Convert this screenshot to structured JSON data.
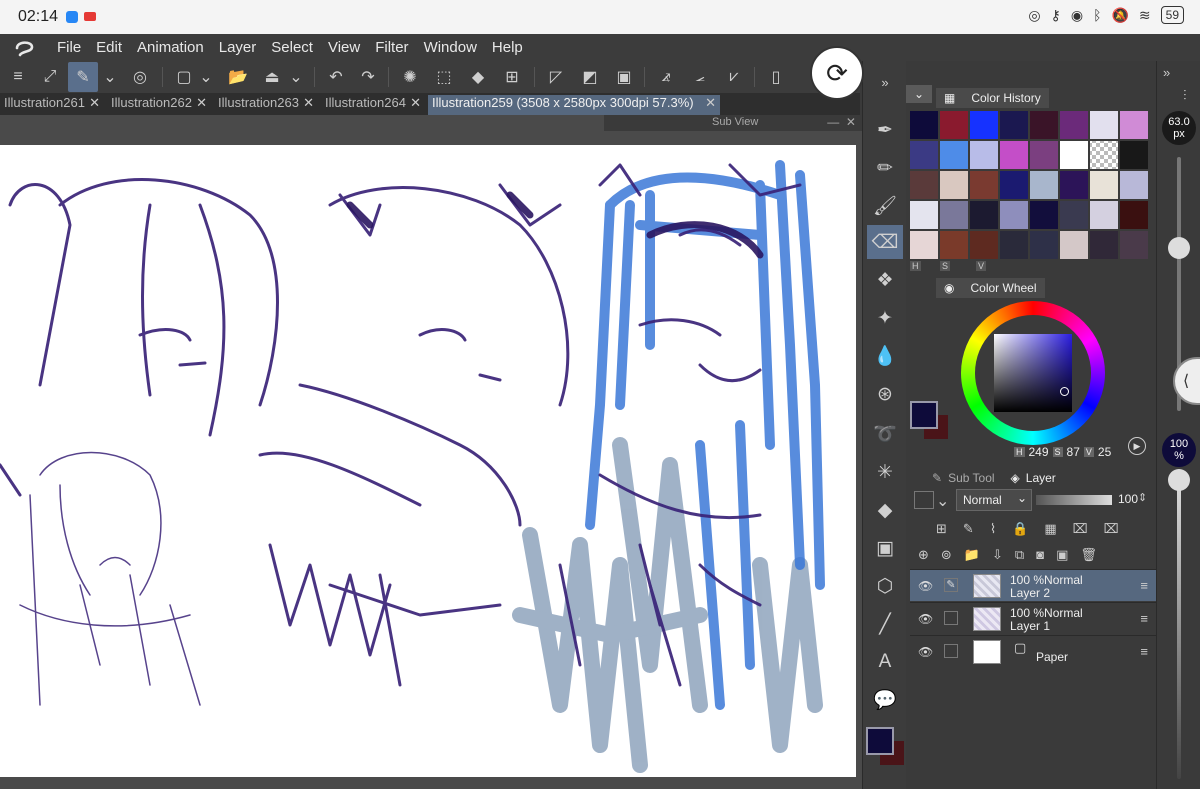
{
  "status": {
    "time": "02:14",
    "battery": "59"
  },
  "menu": {
    "items": [
      "File",
      "Edit",
      "Animation",
      "Layer",
      "Select",
      "View",
      "Filter",
      "Window",
      "Help"
    ]
  },
  "tabs": [
    {
      "label": "Illustration261",
      "active": false
    },
    {
      "label": "Illustration262",
      "active": false
    },
    {
      "label": "Illustration263",
      "active": false
    },
    {
      "label": "Illustration264",
      "active": false
    },
    {
      "label": "Illustration259 (3508 x 2580px 300dpi 57.3%)",
      "active": true
    }
  ],
  "subview": {
    "title": "Sub View"
  },
  "panels": {
    "color_history": {
      "title": "Color History",
      "swatches": [
        "#0e0b3a",
        "#8a1a2e",
        "#1632ff",
        "#1b1850",
        "#3a1428",
        "#6b2a7a",
        "#e2e0ee",
        "#d08bd6",
        "#3b3a84",
        "#4e8ce8",
        "#b8bce8",
        "#c44ec8",
        "#7b3f80",
        "#ffffff",
        "checker",
        "#181818",
        "#5a3a3a",
        "#d9c8c0",
        "#7a3a30",
        "#1b1a70",
        "#a8b6cc",
        "#2c1458",
        "#e8e2d8",
        "#b8b8d8",
        "#e4e4ee",
        "#7a789a",
        "#1c1a30",
        "#8e8ebc",
        "#120e3c",
        "#3a3a50",
        "#d4d0e0",
        "#3a1010",
        "#e6d6d6",
        "#7a3a2a",
        "#5e2a20",
        "#2a2a3a",
        "#2e3048",
        "#d4c8c8",
        "#302838",
        "#4a3a4a"
      ],
      "hsv_tags": [
        "H",
        "S",
        "V"
      ]
    },
    "color_wheel": {
      "title": "Color Wheel",
      "h_label": "H",
      "h": "249",
      "s_label": "S",
      "s": "87",
      "v_label": "V",
      "v": "25"
    },
    "layer": {
      "subtool_tab": "Sub Tool",
      "layer_tab": "Layer",
      "blend_mode": "Normal",
      "opacity": "100",
      "layers": [
        {
          "mode": "100 %Normal",
          "name": "Layer 2",
          "selected": true,
          "editing": true
        },
        {
          "mode": "100 %Normal",
          "name": "Layer 1",
          "selected": false,
          "editing": false
        },
        {
          "mode": "",
          "name": "Paper",
          "selected": false,
          "editing": false
        }
      ]
    }
  },
  "colors": {
    "main": "#0e0b3a",
    "sub": "#4a1418",
    "accent": "#56687f",
    "hair_blue": "#3b78d8",
    "sketch_purple": "#3a2378",
    "gray_blue": "#8fa4bd"
  },
  "sliders": {
    "brush_size": "63.0",
    "brush_unit": "px",
    "opacity": "100",
    "opacity_unit": "%"
  }
}
